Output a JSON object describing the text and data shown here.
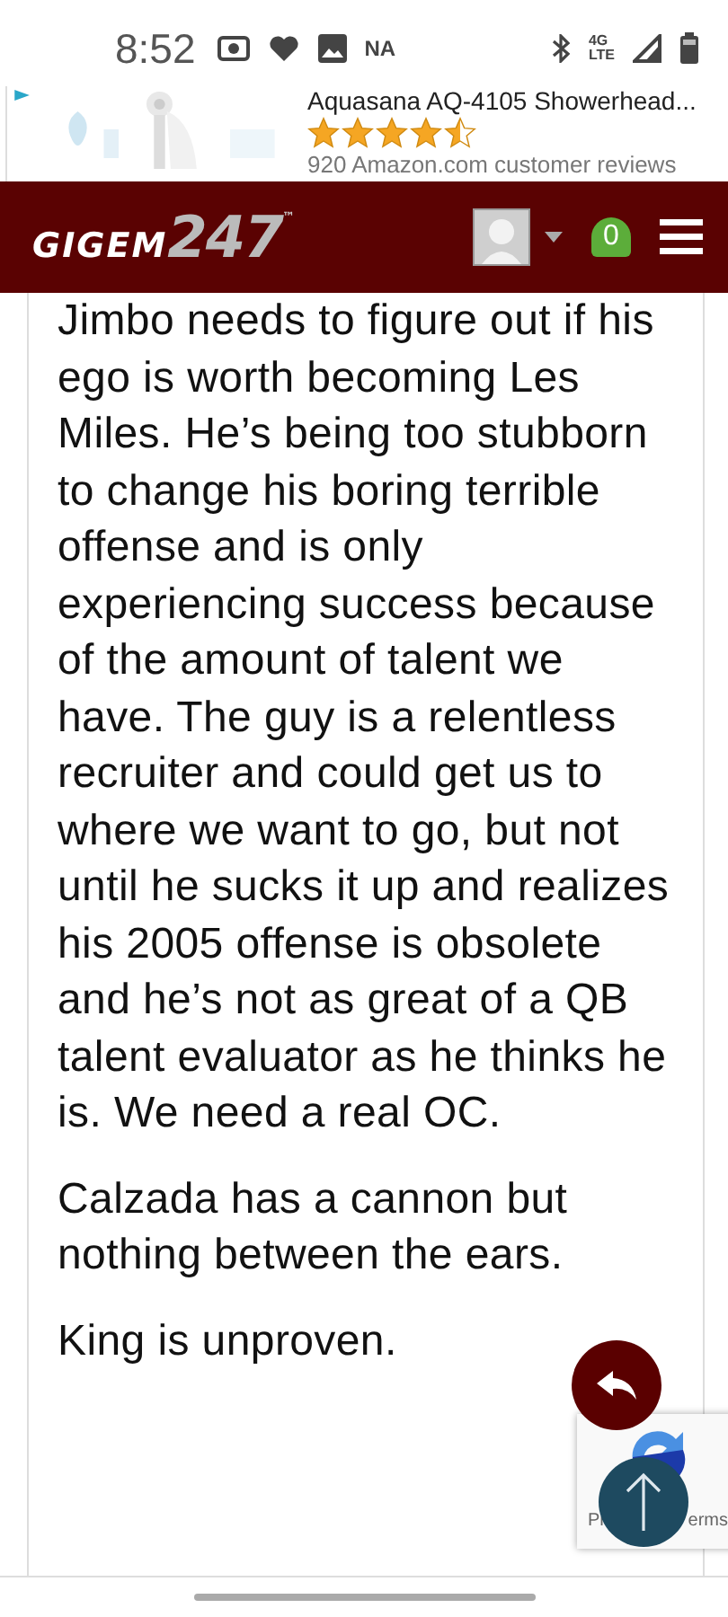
{
  "status_bar": {
    "time": "8:52",
    "carrier_label": "NA",
    "network": "4G",
    "network_sub": "LTE"
  },
  "ad": {
    "title": "Aquasana AQ-4105 Showerhead...",
    "stars": 4.5,
    "reviews": "920 Amazon.com customer reviews"
  },
  "header": {
    "logo_word": "GIGEM",
    "logo_number": "247",
    "logo_mark": "™",
    "notifications": "0"
  },
  "post": {
    "paragraphs": [
      "Jimbo needs to figure out if his ego is worth becoming Les Miles. He’s being too stubborn to change his boring terrible offense and is only experiencing success because of the amount of talent we have. The guy is a relentless recruiter and could get us to where we want to go, but not until he sucks it up and realizes his 2005 offense is obsolete and he’s not as great of a QB talent evaluator as he thinks he is. We need a real OC.",
      "Calzada has a cannon but nothing between the ears.",
      "King is unproven."
    ]
  },
  "recaptcha": {
    "left_text": "Pr",
    "right_text": "erms"
  }
}
